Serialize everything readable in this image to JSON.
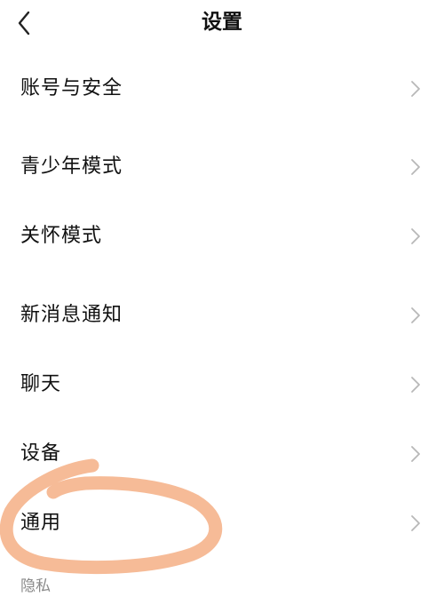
{
  "header": {
    "title": "设置",
    "back_icon": "chevron-left-icon"
  },
  "items": [
    {
      "label": "账号与安全",
      "icon": "chevron-right-icon"
    },
    {
      "label": "青少年模式",
      "icon": "chevron-right-icon"
    },
    {
      "label": "关怀模式",
      "icon": "chevron-right-icon"
    },
    {
      "label": "新消息通知",
      "icon": "chevron-right-icon"
    },
    {
      "label": "聊天",
      "icon": "chevron-right-icon"
    },
    {
      "label": "设备",
      "icon": "chevron-right-icon"
    },
    {
      "label": "通用",
      "icon": "chevron-right-icon"
    }
  ],
  "section": {
    "privacy_label": "隐私"
  },
  "colors": {
    "background": "#ffffff",
    "text": "#111111",
    "chevron": "#b8b8b8",
    "section_label": "#8a8a8a",
    "highlight_mark": "#f5b48c"
  }
}
